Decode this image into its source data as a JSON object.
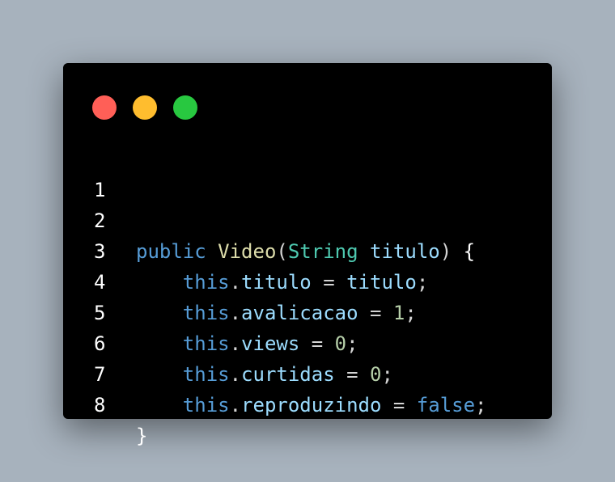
{
  "window": {
    "traffic_lights": [
      {
        "name": "close",
        "color": "#ff5f57"
      },
      {
        "name": "minimize",
        "color": "#ffbd2e"
      },
      {
        "name": "maximize",
        "color": "#28c840"
      }
    ]
  },
  "code": {
    "line_numbers": [
      "1",
      "2",
      "3",
      "4",
      "5",
      "6",
      "7",
      "8"
    ],
    "line2": {
      "kw_public": "public",
      "fn_name": "Video",
      "paren_open": "(",
      "type": "String",
      "param": "titulo",
      "paren_close": ")",
      "brace_open": "{"
    },
    "line3": {
      "this": "this",
      "dot": ".",
      "field": "titulo",
      "eq": "=",
      "value": "titulo",
      "semi": ";"
    },
    "line4": {
      "this": "this",
      "dot": ".",
      "field": "avalicacao",
      "eq": "=",
      "value": "1",
      "semi": ";"
    },
    "line5": {
      "this": "this",
      "dot": ".",
      "field": "views",
      "eq": "=",
      "value": "0",
      "semi": ";"
    },
    "line6": {
      "this": "this",
      "dot": ".",
      "field": "curtidas",
      "eq": "=",
      "value": "0",
      "semi": ";"
    },
    "line7": {
      "this": "this",
      "dot": ".",
      "field": "reproduzindo",
      "eq": "=",
      "value": "false",
      "semi": ";"
    },
    "line8": {
      "brace_close": "}"
    }
  }
}
